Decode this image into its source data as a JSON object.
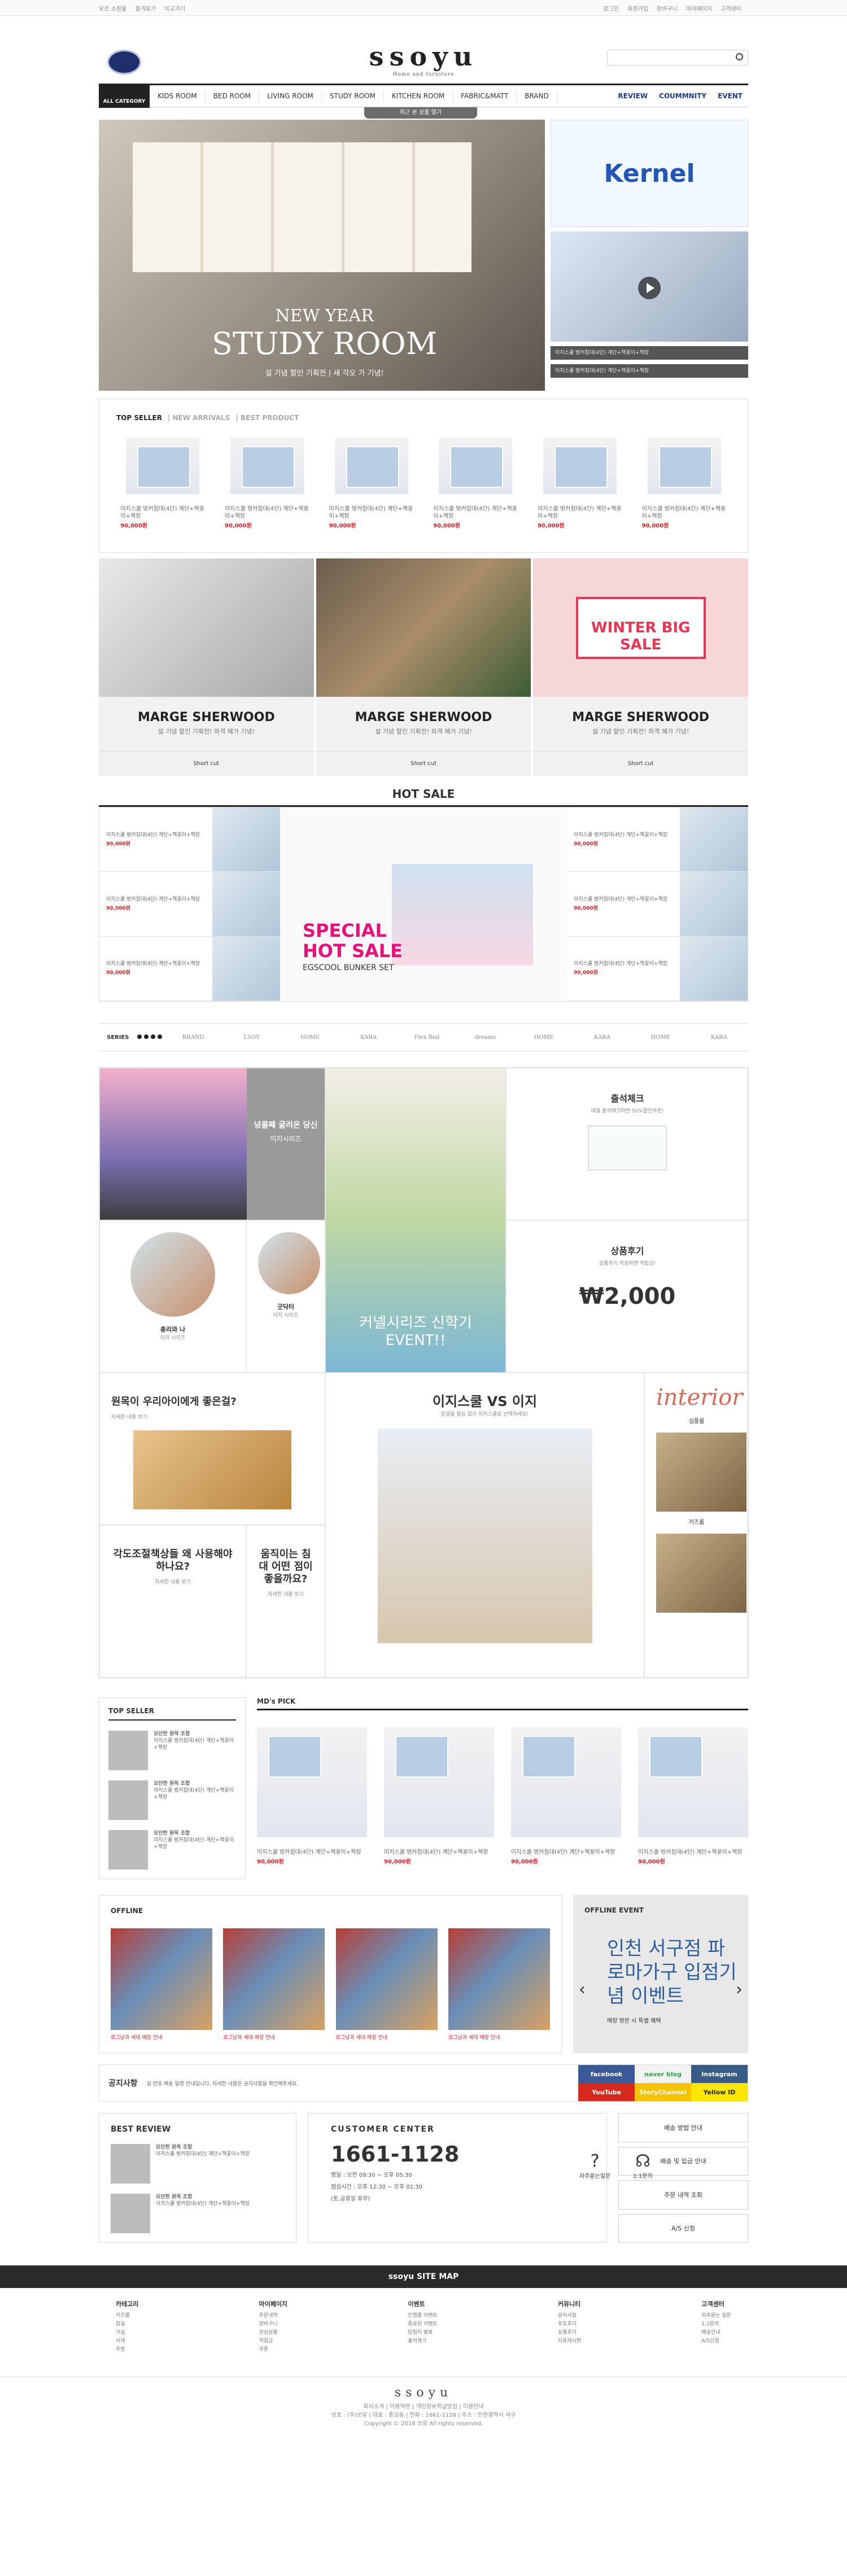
{
  "top": {
    "left": [
      "요르 쇼핑몰",
      "즐겨찾기",
      "비교가기"
    ],
    "right": [
      "로그인",
      "회원가입",
      "장바구니",
      "마이페이지",
      "고객센터"
    ]
  },
  "brand": {
    "name": "ssoyu",
    "tag": "Home and furniture"
  },
  "nav": {
    "all": "ALL CATEGORY",
    "items": [
      "KIDS ROOM",
      "BED ROOM",
      "LIVING ROOM",
      "STUDY ROOM",
      "KITCHEN ROOM",
      "FABRIC&MATT",
      "BRAND"
    ],
    "sub": [
      "REVIEW",
      "COUMMNITY",
      "EVENT"
    ],
    "recent": "최근 본 상품 열기"
  },
  "hero": {
    "line1": "NEW YEAR",
    "line2": "STUDY ROOM",
    "line3": "설 기념 할인 기획전 | 새 각오 가 기념!",
    "side1": "Kernel",
    "vid": [
      "이지스쿨 벙커침대(4단) 계단+책꽂이+책장",
      "이지스쿨 벙커침대(4단) 계단+책꽂이+책장"
    ]
  },
  "tabs": [
    "TOP SELLER",
    "NEW ARRIVALS",
    "BEST PRODUCT"
  ],
  "product": {
    "desc": "이지스쿨 벙커침대(4단) 계단+책꽂이+책장",
    "price": "90,000원"
  },
  "banners": [
    {
      "title": "MARGE SHERWOOD",
      "sub": "설 기념 할인 기획전! 파격 혜가 기념!"
    },
    {
      "title": "MARGE SHERWOOD",
      "sub": "설 기념 할인 기획전! 파격 혜가 기념!"
    },
    {
      "title": "MARGE SHERWOOD",
      "sub": "설 기념 할인 기획전! 파격 혜가 기념!",
      "badge": "WINTER BIG SALE"
    }
  ],
  "shortcut": "Short cut",
  "hotsale": {
    "title": "HOT SALE",
    "t1": "SPECIAL",
    "t2": "HOT SALE",
    "t3": "EGSCOOL BUNKER SET"
  },
  "series": {
    "label": "SERIES",
    "logos": [
      "BRAND",
      "LSOY",
      "HOME",
      "KARA",
      "Flex Bed",
      "dreams",
      "HOME",
      "KARA",
      "HOME",
      "KARA"
    ]
  },
  "grid": {
    "tv": "넝쿨째 굴러온 당신",
    "tvs": "이지시리즈",
    "ch": "출석체크",
    "chs": "매일 출석체크하면 50%할인쿠폰!",
    "boy": "커넬시리즈 신학기 EVENT!!",
    "rv": "상품후기",
    "rvs": "상품후기 작성하면 적립금!",
    "rvamt": "₩2,000",
    "c1": "총리와 나",
    "c1s": "이지 시리즈",
    "c2": "굿닥터",
    "c2s": "이지 시리즈",
    "q1": "원목이 우리아이에게 좋은걸?",
    "q1s": "자세한 내용 보기",
    "q2": "각도조절책상들 왜 사용해야하나요?",
    "q2s": "자세한 내용 보기",
    "q3": "움직이는 침대 어떤 점이 좋을까요?",
    "q3s": "자세한 내용 보기",
    "vs": "이지스쿨 VS 이지",
    "vss": "망설일 필요 없이 이지스쿨로 선택하세요!",
    "int": "interior",
    "int1": "심플룸",
    "int2": "키즈룸"
  },
  "ts": {
    "title": "TOP SELLER",
    "item": "모던한 원목 조합"
  },
  "md": {
    "title": "MD's PICK"
  },
  "offline": {
    "title": "OFFLINE",
    "item": "로그남과 세대 매장 안내",
    "evt": "OFFLINE EVENT",
    "evtt": "인천 서구점 파로마가구 입점기념 이벤트",
    "evts": "매장 방문 시 특별 혜택"
  },
  "notice": {
    "title": "공지사항",
    "text": "설 연휴 배송 일정 안내입니다. 자세한 내용은 공지사항을 확인해주세요.",
    "sns": [
      "facebook",
      "naver blog",
      "Instagram",
      "YouTube",
      "StoryChannel",
      "Yellow ID"
    ]
  },
  "cs": {
    "br": "BEST REVIEW",
    "cc": "CUSTOMER CENTER",
    "phone": "1661-1128",
    "h1": "평일 : 오전 09:30 ~ 오후 05:30",
    "h2": "점심시간 : 오후 12:30 ~ 오후 01:30",
    "h3": "(토,공휴일 휴무)",
    "faq": "자주묻는질문",
    "q": "1:1문의",
    "btns": [
      "배송 방법 안내",
      "배송 및 입금 안내",
      "주문 내역 조회",
      "A/S 신청"
    ]
  },
  "sitemap": {
    "title": "ssoyu SITE MAP",
    "cols": [
      {
        "h": "카테고리",
        "i": [
          "키즈룸",
          "침실",
          "거실",
          "서재",
          "주방"
        ]
      },
      {
        "h": "마이페이지",
        "i": [
          "주문내역",
          "장바구니",
          "관심상품",
          "적립금",
          "쿠폰"
        ]
      },
      {
        "h": "이벤트",
        "i": [
          "진행중 이벤트",
          "종료된 이벤트",
          "당첨자 발표",
          "출석체크"
        ]
      },
      {
        "h": "커뮤니티",
        "i": [
          "공지사항",
          "포토후기",
          "상품후기",
          "자유게시판"
        ]
      },
      {
        "h": "고객센터",
        "i": [
          "자주묻는 질문",
          "1:1문의",
          "배송안내",
          "A/S신청"
        ]
      }
    ]
  },
  "footer": {
    "links": "회사소개 | 이용약관 | 개인정보취급방침 | 이용안내",
    "addr": "상호 : (주)쏘유 | 대표 : 홍길동 | 전화 : 1661-1128 | 주소 : 인천광역시 서구",
    "copy": "Copyright © 2016 쏘유 All rights reserved.",
    "logo": "ssoyu"
  }
}
